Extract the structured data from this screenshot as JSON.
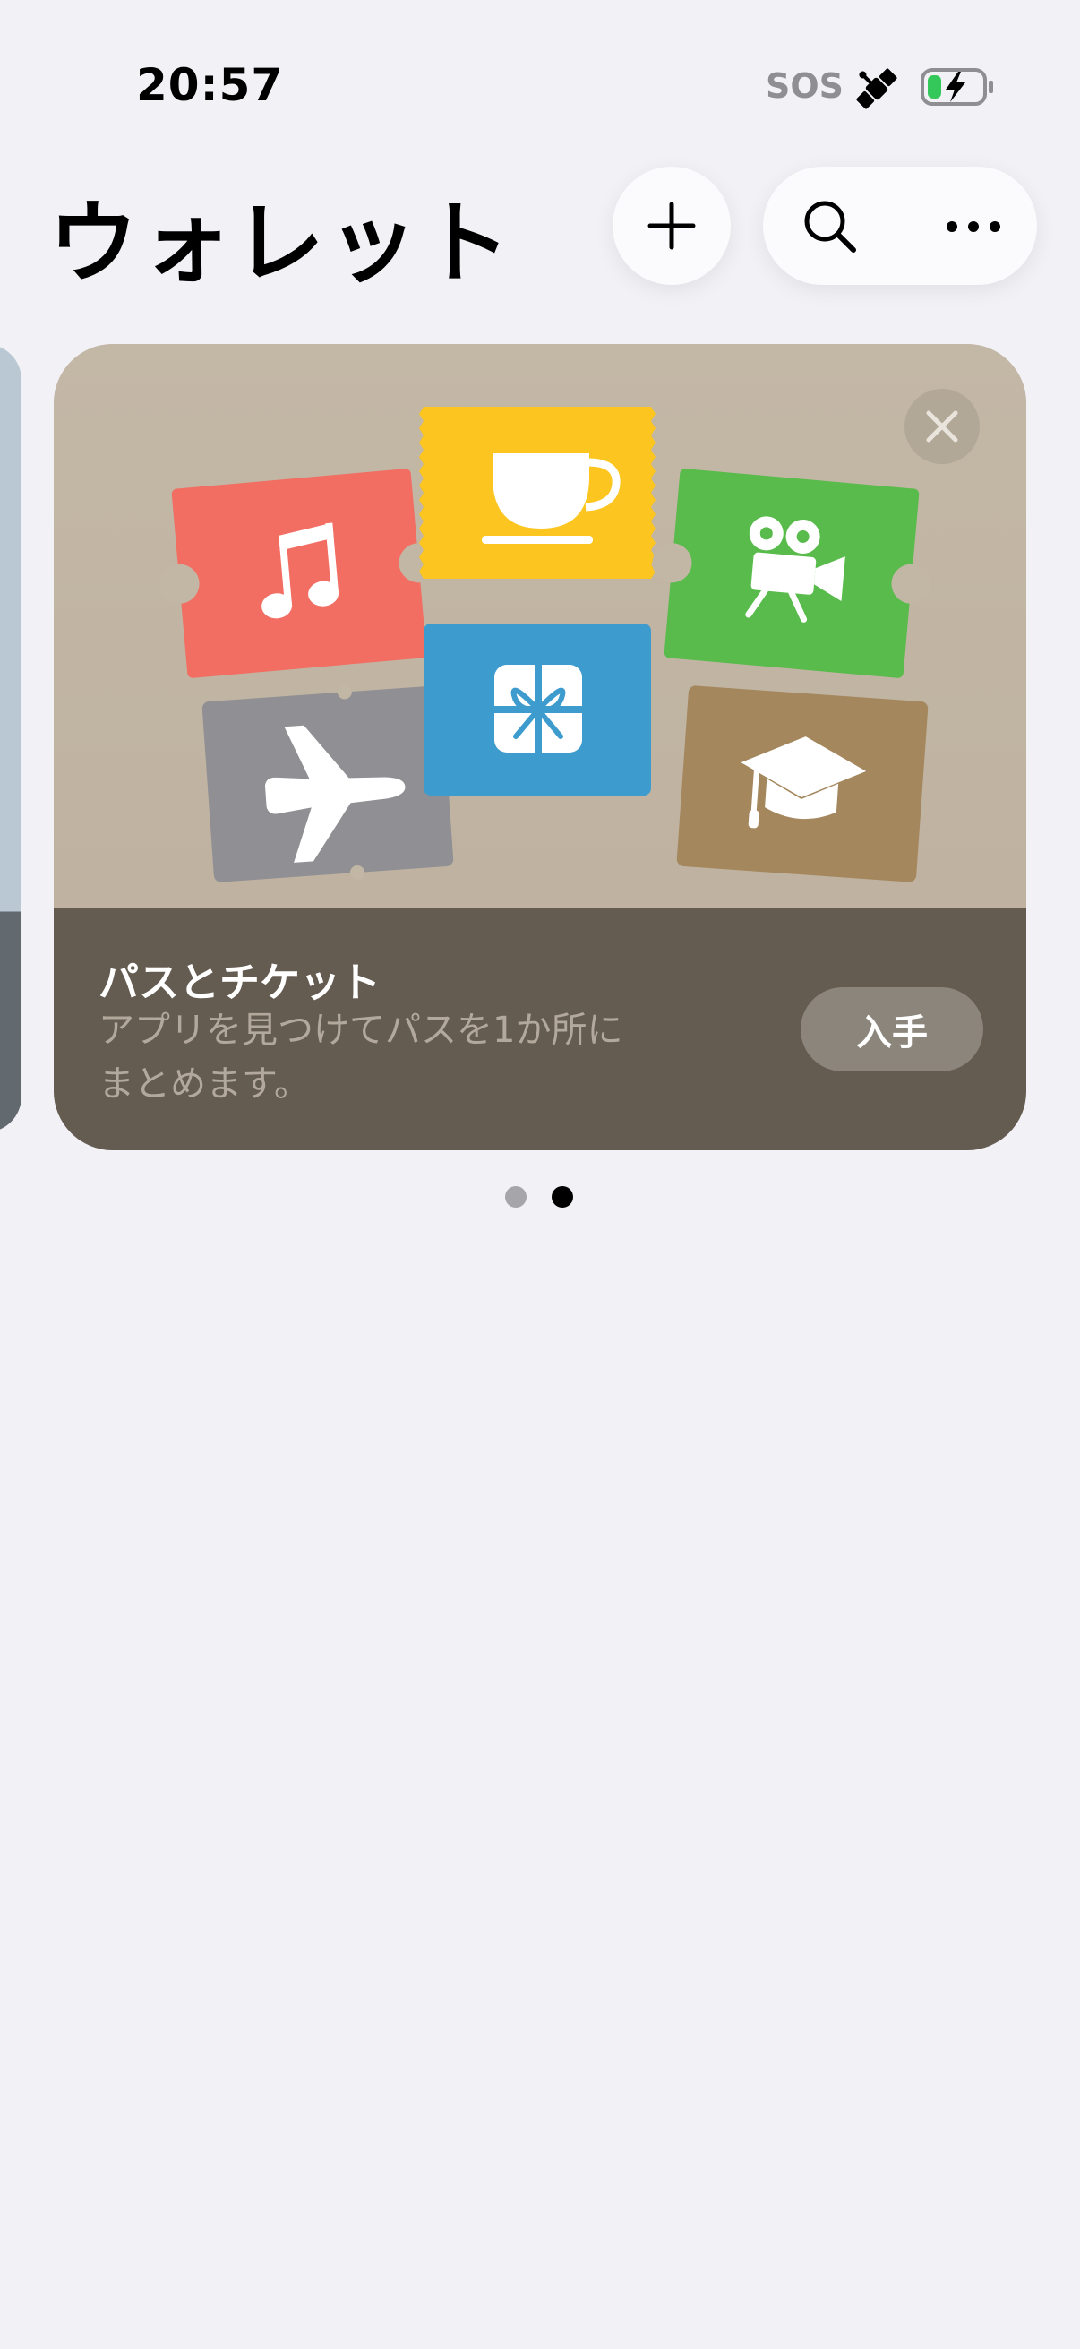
{
  "status_bar": {
    "time": "20:57",
    "sos": "SOS",
    "icons": [
      "satellite-icon",
      "battery-charging-icon"
    ],
    "battery_fill_fraction": 0.2
  },
  "header": {
    "title": "ウォレット",
    "buttons": [
      "add-icon",
      "search-icon",
      "more-icon"
    ]
  },
  "promo_card": {
    "title": "パスとチケット",
    "subtitle_line1": "アプリを見つけてパスを1か所に",
    "subtitle_line2": "まとめます。",
    "get_button": "入手",
    "tiles": [
      {
        "icon": "music-note-icon",
        "color": "#f26d62"
      },
      {
        "icon": "coffee-cup-icon",
        "color": "#fcc51f"
      },
      {
        "icon": "movie-camera-icon",
        "color": "#58bb4b"
      },
      {
        "icon": "airplane-icon",
        "color": "#8f8f94"
      },
      {
        "icon": "gift-icon",
        "color": "#3d9ccd"
      },
      {
        "icon": "graduation-cap-icon",
        "color": "#a4875d"
      }
    ],
    "colors": {
      "art_bg": "#c2b6a5",
      "bottom_bg": "#645b51"
    }
  },
  "pagination": {
    "total": 2,
    "current": 2
  }
}
